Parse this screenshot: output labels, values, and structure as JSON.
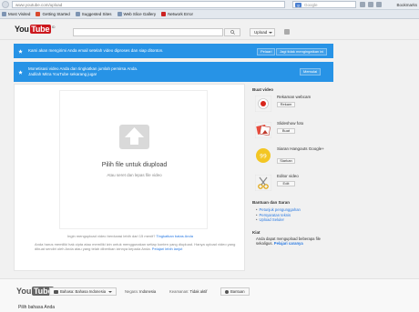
{
  "browser": {
    "url": "www.youtube.com/upload",
    "search_placeholder": "Google",
    "search_engine_icon": "google-g-icon",
    "bookmarks_right": "Bookmarks",
    "bookmarks": [
      {
        "label": "Most Visited",
        "icon": "bookmark-icon"
      },
      {
        "label": "Getting Started",
        "icon": "firefox-icon"
      },
      {
        "label": "Suggested Sites",
        "icon": "bookmark-icon"
      },
      {
        "label": "Web Slice Gallery",
        "icon": "bookmark-icon"
      },
      {
        "label": "Network Error",
        "icon": "youtube-icon"
      }
    ]
  },
  "header": {
    "logo_you": "You",
    "logo_tube": "Tube",
    "logo_tld": "ID",
    "upload_label": "Upload"
  },
  "banners": [
    {
      "text": "Kami akan mengirimi Anda email setelah video diproses dan siap ditonton.",
      "btn1": "Pelaari",
      "btn2": "Jagi tidak mengingatkan ini"
    },
    {
      "text": "Monetisasi video Anda dan tingkatkan jumlah pemirsa Anda.",
      "text2": "Jadilah Mitra YouTube sekarang juga!",
      "btn1": "Memulai"
    }
  ],
  "upload": {
    "choose_label": "Pilih file untuk diupload",
    "drag_label": "Atau seret dan lepas file video",
    "note1_pre": "Ingin mengupload video berdurasi lebih dari 15 menit?",
    "note1_link": "Tingkatkan batas Anda",
    "note2_pre": "Anda harus memiliki hak cipta atau memiliki izin untuk menggunakan setiap konten yang diupload. Hanya upload video yang dibuat sendiri oleh Anda atau yang telah diberikan izinnya kepada Anda.",
    "note2_link": "Pelajari lebih lanjut"
  },
  "sidebar": {
    "title": "Buat video",
    "options": [
      {
        "label": "Rekaman webcam",
        "btn": "Rekam",
        "icon": "webcam-record-icon"
      },
      {
        "label": "Slideshow foto",
        "btn": "Buat",
        "icon": "photo-slideshow-icon"
      },
      {
        "label": "Siaran Hangouts Google+",
        "btn": "Siarkan",
        "icon": "google-hangouts-icon"
      },
      {
        "label": "Editor video",
        "btn": "Edit",
        "icon": "video-editor-icon"
      }
    ],
    "help_title": "Bantuan dan Saran",
    "help_items": [
      "Petunjuk pengunggahan",
      "Persyaratan teknis",
      "Upload Seluler"
    ],
    "hint_title": "Kiat",
    "hint_text": "Anda dapat mengupload beberapa file sekaligus.",
    "hint_link": "Pelajari caranya"
  },
  "footer": {
    "logo_you": "You",
    "logo_tube": "Tube",
    "language_btn": "Bahasa: Bahasa Indonesia",
    "country_label": "Negara:",
    "country_value": "Indonesia",
    "safety_label": "Keamanan:",
    "safety_value": "Tidak aktif",
    "help_btn": "Bantuan",
    "lang_heading": "Pilih bahasa Anda"
  },
  "colors": {
    "banner_blue": "#2793e6",
    "youtube_red": "#cc181e",
    "link_blue": "#2a7ae2"
  }
}
